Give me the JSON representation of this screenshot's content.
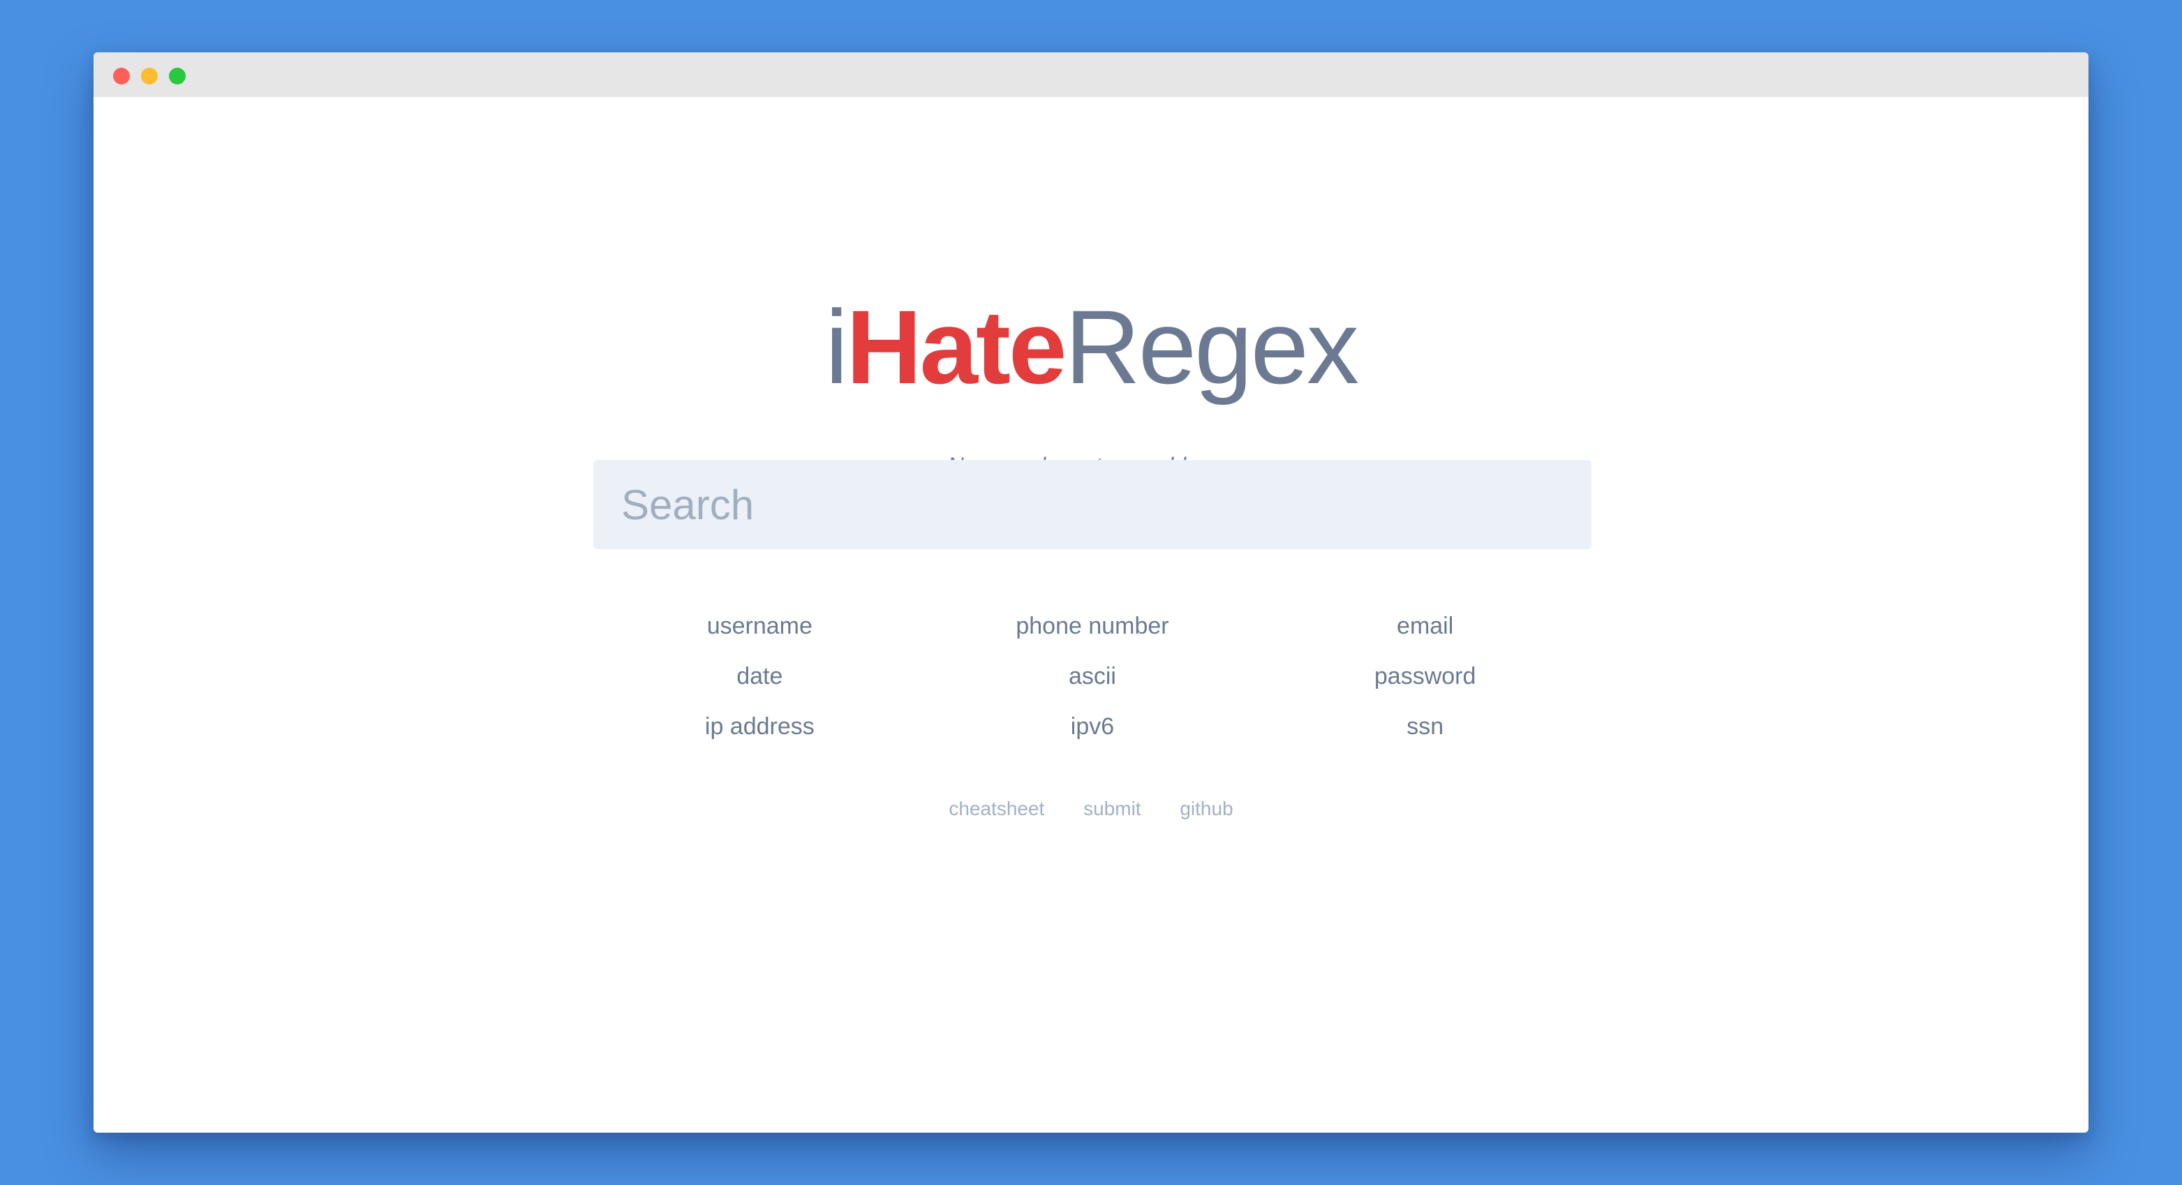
{
  "colors": {
    "background": "#4a90e2",
    "window": "#ffffff",
    "titlebar": "#e6e6e6",
    "close_dot": "#ff5f57",
    "minimize_dot": "#febc2e",
    "maximize_dot": "#28c840",
    "logo_accent": "#e23c3c",
    "logo_gray": "#6b7a92",
    "search_bg": "#ecf1f8"
  },
  "logo": {
    "part_i": "i",
    "part_hate": "Hate",
    "part_regex": "Regex"
  },
  "tagline": "Now you have two problems.",
  "search": {
    "placeholder": "Search",
    "value": ""
  },
  "quick_links": [
    "username",
    "phone number",
    "email",
    "date",
    "ascii",
    "password",
    "ip address",
    "ipv6",
    "ssn"
  ],
  "footer_links": [
    "cheatsheet",
    "submit",
    "github"
  ]
}
